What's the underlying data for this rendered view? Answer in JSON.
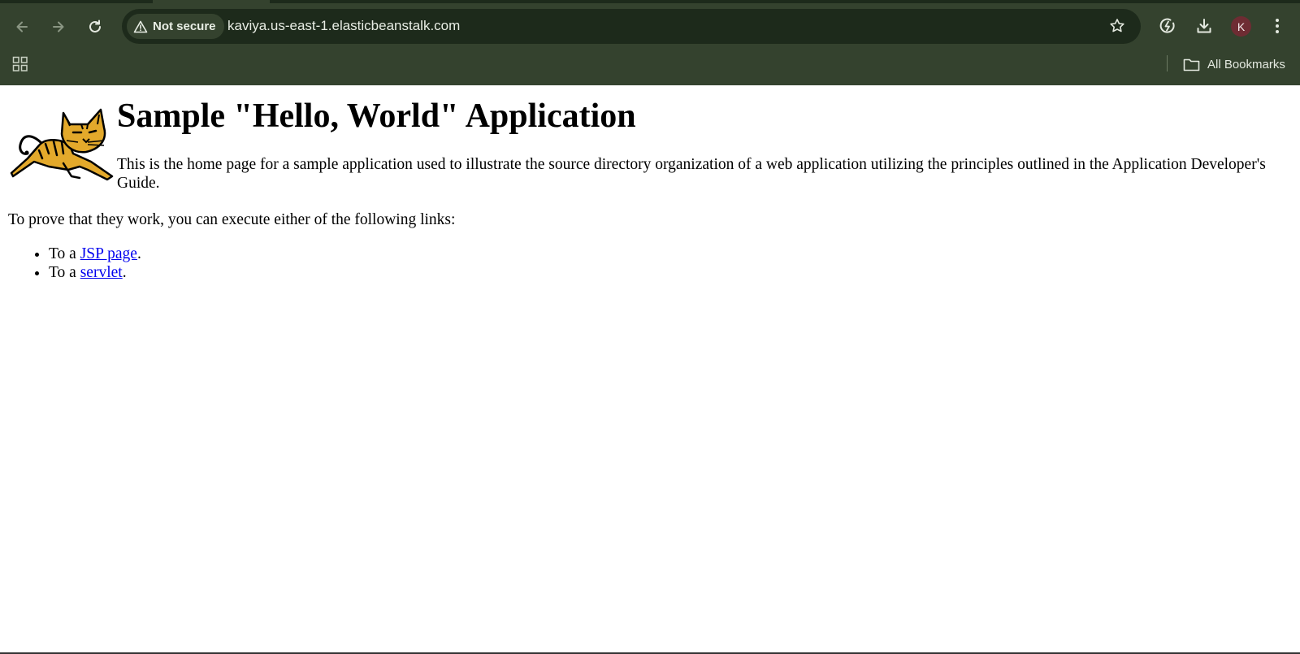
{
  "browser": {
    "security_label": "Not secure",
    "url": "kaviya.us-east-1.elasticbeanstalk.com",
    "profile_initial": "K",
    "bookmarks_label": "All Bookmarks",
    "icons": [
      "back-icon",
      "forward-icon",
      "reload-icon",
      "warning-icon",
      "star-icon",
      "performance-icon",
      "download-icon",
      "kebab-menu-icon",
      "apps-grid-icon",
      "folder-icon"
    ]
  },
  "page": {
    "title": "Sample \"Hello, World\" Application",
    "intro": "This is the home page for a sample application used to illustrate the source directory organization of a web application utilizing the principles outlined in the Application Developer's Guide.",
    "prove_text": "To prove that they work, you can execute either of the following links:",
    "links": [
      {
        "prefix": "To a ",
        "link_text": "JSP page",
        "suffix": "."
      },
      {
        "prefix": "To a ",
        "link_text": "servlet",
        "suffix": "."
      }
    ]
  },
  "colors": {
    "chrome_bg": "#34422e",
    "omnibox_bg": "#1d2a1b",
    "link": "#0000ee",
    "logo_fill": "#e3a92b"
  }
}
